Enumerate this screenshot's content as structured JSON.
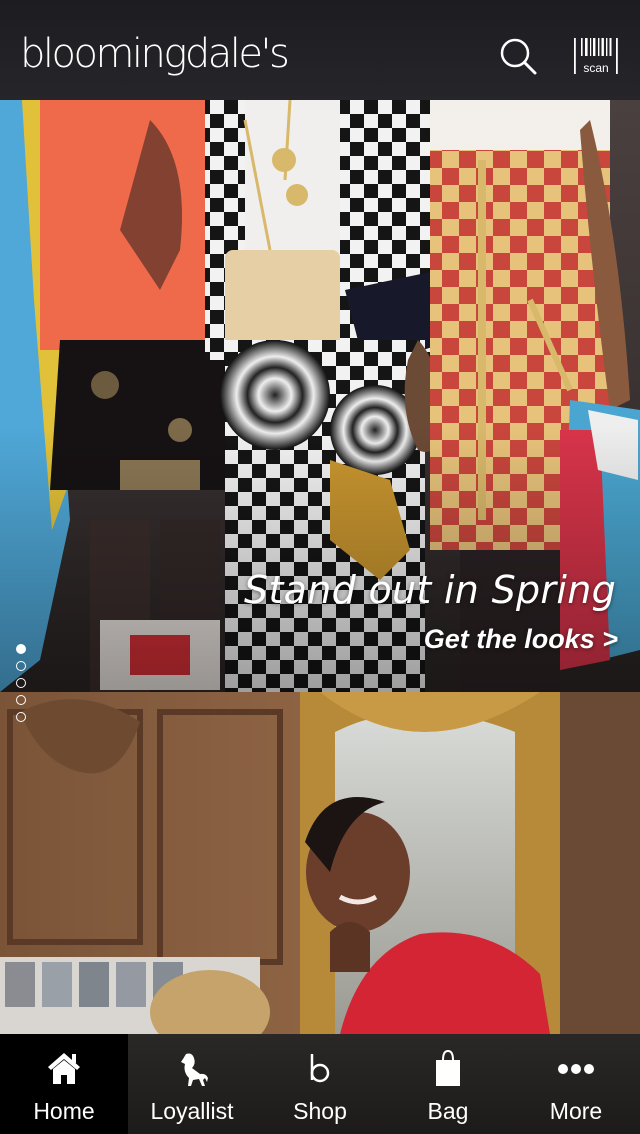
{
  "header": {
    "logo_text": "bloomingdale's",
    "scan_label": "scan",
    "icons": {
      "search": "search-icon",
      "scan": "barcode-scan-icon"
    }
  },
  "hero": {
    "title": "Stand out in Spring",
    "cta": "Get the looks >",
    "carousel": {
      "total": 5,
      "active": 1
    }
  },
  "tabs": [
    {
      "label": "Home",
      "icon": "home-icon",
      "active": true
    },
    {
      "label": "Loyallist",
      "icon": "dog-icon",
      "active": false
    },
    {
      "label": "Shop",
      "icon": "shop-b-icon",
      "active": false
    },
    {
      "label": "Bag",
      "icon": "bag-icon",
      "active": false
    },
    {
      "label": "More",
      "icon": "more-dots-icon",
      "active": false
    }
  ],
  "colors": {
    "header_bg": "#232226",
    "tabbar_bg": "#242220",
    "active_tab_bg": "#000000",
    "text": "#ffffff"
  }
}
